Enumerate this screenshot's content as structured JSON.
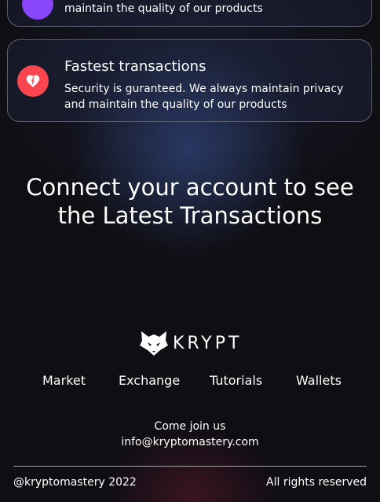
{
  "cards": {
    "top_partial": {
      "description_line": "maintain the quality of our products"
    },
    "fastest": {
      "title": "Fastest transactions",
      "description": "Security is guranteed. We always maintain privacy and maintain the quality of our products",
      "icon": "heart-icon",
      "icon_color": "#f84550"
    }
  },
  "headline": {
    "line1": "Connect your account to see",
    "line2": "the Latest Transactions"
  },
  "footer": {
    "brand": "KRYPT",
    "nav": [
      "Market",
      "Exchange",
      "Tutorials",
      "Wallets"
    ],
    "join": "Come join us",
    "email": "info@kryptomastery.com",
    "copyright": "@kryptomastery 2022",
    "rights": "All rights reserved"
  },
  "colors": {
    "background": "#0f0e13",
    "accent_red": "#f84550",
    "accent_purple": "#8945f8"
  }
}
